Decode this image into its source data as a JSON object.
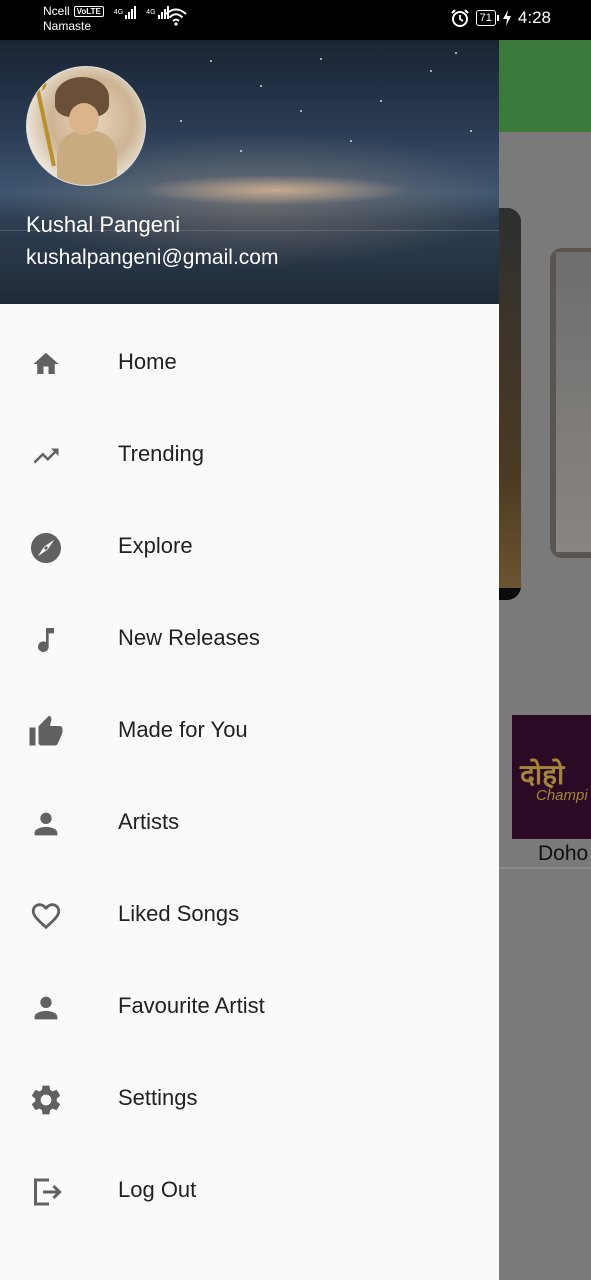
{
  "status_bar": {
    "carrier": "Ncell",
    "volte": "VoLTE",
    "network_name": "Namaste",
    "net_type_1": "4G",
    "net_type_2": "4G",
    "battery": "71",
    "time": "4:28"
  },
  "drawer": {
    "user_name": "Kushal Pangeni",
    "user_email": "kushalpangeni@gmail.com",
    "items": [
      {
        "label": "Home",
        "icon": "home-icon"
      },
      {
        "label": "Trending",
        "icon": "trending-icon"
      },
      {
        "label": "Explore",
        "icon": "explore-icon"
      },
      {
        "label": "New Releases",
        "icon": "music-note-icon"
      },
      {
        "label": "Made for You",
        "icon": "thumb-up-icon"
      },
      {
        "label": "Artists",
        "icon": "person-icon"
      },
      {
        "label": "Liked Songs",
        "icon": "heart-icon"
      },
      {
        "label": "Favourite Artist",
        "icon": "person-icon"
      },
      {
        "label": "Settings",
        "icon": "gear-icon"
      },
      {
        "label": "Log Out",
        "icon": "logout-icon"
      }
    ]
  },
  "background": {
    "thumb_title": "दोहो",
    "thumb_subtitle": "Champi",
    "thumb_label": "Doho"
  },
  "colors": {
    "icon": "#616161",
    "drawer_bg": "#fafafa",
    "app_bar": "#3c7a3c",
    "scrim": "#7a7a7a"
  }
}
